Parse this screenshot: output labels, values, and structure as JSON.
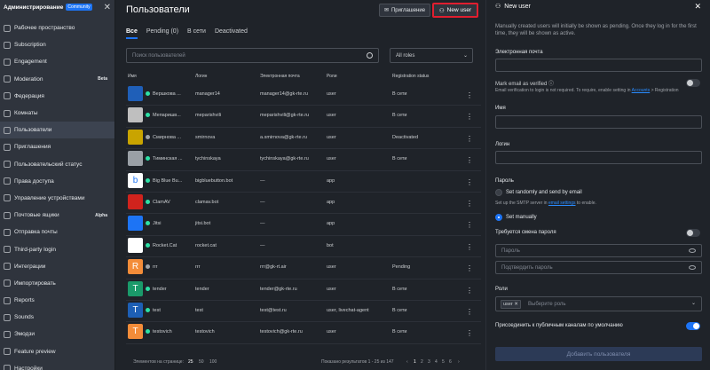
{
  "sidebar": {
    "title": "Администрирование",
    "badge": "Community",
    "items": [
      {
        "label": "Рабочее пространство",
        "icon": "workspace-icon"
      },
      {
        "label": "Subscription",
        "icon": "card-icon"
      },
      {
        "label": "Engagement",
        "icon": "chart-icon"
      },
      {
        "label": "Moderation",
        "icon": "shield-icon",
        "badge": "Beta"
      },
      {
        "label": "Федерация",
        "icon": "globe-icon"
      },
      {
        "label": "Комнаты",
        "icon": "hash-icon"
      },
      {
        "label": "Пользователи",
        "icon": "users-icon",
        "active": true
      },
      {
        "label": "Приглашения",
        "icon": "mail-icon"
      },
      {
        "label": "Пользовательский статус",
        "icon": "status-icon"
      },
      {
        "label": "Права доступа",
        "icon": "key-icon"
      },
      {
        "label": "Управление устройствами",
        "icon": "devices-icon"
      },
      {
        "label": "Почтовые ящики",
        "icon": "inbox-icon",
        "badge": "Alpha"
      },
      {
        "label": "Отправка почты",
        "icon": "send-icon"
      },
      {
        "label": "Third-party login",
        "icon": "login-icon"
      },
      {
        "label": "Интеграции",
        "icon": "code-icon"
      },
      {
        "label": "Импортировать",
        "icon": "import-icon"
      },
      {
        "label": "Reports",
        "icon": "report-icon"
      },
      {
        "label": "Sounds",
        "icon": "sound-icon"
      },
      {
        "label": "Эмодзи",
        "icon": "emoji-icon"
      },
      {
        "label": "Feature preview",
        "icon": "flask-icon"
      },
      {
        "label": "Настройки",
        "icon": "gear-icon"
      }
    ]
  },
  "main": {
    "title": "Пользователи",
    "invite_label": "Приглашение",
    "new_user_label": "New user",
    "tabs": [
      "Все",
      "Pending (0)",
      "В сети",
      "Deactivated"
    ],
    "search_placeholder": "Поиск пользователей",
    "roles_select": "All roles",
    "columns": [
      "Имя",
      "Логин",
      "Электронная почта",
      "Роли",
      "Registration status"
    ],
    "rows": [
      {
        "name": "Вершкова ...",
        "login": "manager14",
        "email": "manager14@gk-rte.ru",
        "roles": "user",
        "status": "В сети",
        "color": "#1f5fb8",
        "initial": "",
        "online": true
      },
      {
        "name": "Мепаришв...",
        "login": "meparishvili",
        "email": "meparishvili@gk-rte.ru",
        "roles": "user",
        "status": "В сети",
        "color": "#bfbfbf",
        "initial": "",
        "online": true
      },
      {
        "name": "Смирнова ...",
        "login": "smirnova",
        "email": "a.smirnova@gk-rte.ru",
        "roles": "user",
        "status": "Deactivated",
        "color": "#c9a400",
        "initial": "",
        "online": false
      },
      {
        "name": "Тиминская ...",
        "login": "tychinskaya",
        "email": "tychinskaya@gk-rte.ru",
        "roles": "user",
        "status": "В сети",
        "color": "#9aa0a6",
        "initial": "",
        "online": true
      },
      {
        "name": "Big Blue Bu...",
        "login": "bigbluebutton.bot",
        "email": "—",
        "roles": "app",
        "status": "",
        "color": "#ffffff",
        "initial": "b",
        "online": true
      },
      {
        "name": "ClamAV",
        "login": "clamav.bot",
        "email": "—",
        "roles": "app",
        "status": "",
        "color": "#d0231d",
        "initial": "",
        "online": true
      },
      {
        "name": "Jitsi",
        "login": "jitsi.bot",
        "email": "—",
        "roles": "app",
        "status": "",
        "color": "#1d74f5",
        "initial": "",
        "online": true
      },
      {
        "name": "Rocket.Cat",
        "login": "rocket.cat",
        "email": "—",
        "roles": "bot",
        "status": "",
        "color": "#ffffff",
        "initial": "",
        "online": true
      },
      {
        "name": "rrr",
        "login": "rrr",
        "email": "rrr@gk-rt.air",
        "roles": "user",
        "status": "Pending",
        "color": "#f38c39",
        "initial": "R",
        "online": false
      },
      {
        "name": "tender",
        "login": "tender",
        "email": "tender@gk-rte.ru",
        "roles": "user",
        "status": "В сети",
        "color": "#1a9a6a",
        "initial": "T",
        "online": true
      },
      {
        "name": "test",
        "login": "test",
        "email": "test@test.ru",
        "roles": "user, livechat-agent",
        "status": "В сети",
        "color": "#1d5fb5",
        "initial": "T",
        "online": true
      },
      {
        "name": "testovich",
        "login": "testovich",
        "email": "testovich@gk-rte.ru",
        "roles": "user",
        "status": "В сети",
        "color": "#f38c39",
        "initial": "T",
        "online": true
      }
    ],
    "pager": {
      "items_per_page_label": "Элементов на странице:",
      "sizes": [
        "25",
        "50",
        "100"
      ],
      "results": "Показано результатов 1 - 25 из 147",
      "pages": [
        "1",
        "2",
        "3",
        "4",
        "5",
        "6"
      ]
    }
  },
  "panel": {
    "title": "New user",
    "note": "Manually created users will initially be shown as pending. Once they log in for the first time, they will be shown as active.",
    "email_label": "Электронная почта",
    "verified_label": "Mark email as verified",
    "verified_note_prefix": "Email verification to login is not required. To require, enable setting in",
    "verified_note_link": "Accounts",
    "verified_note_suffix": "> Registration",
    "name_label": "Имя",
    "login_label": "Логин",
    "password_section": "Пароль",
    "set_random_label": "Set randomly and send by email",
    "smtp_note_prefix": "Set up the SMTP server in",
    "smtp_note_link": "email settings",
    "smtp_note_suffix": "to enable.",
    "set_manually_label": "Set manually",
    "require_change_label": "Требуется смена пароля",
    "password_placeholder": "Пароль",
    "confirm_placeholder": "Подтвердить пароль",
    "roles_label": "Роли",
    "role_chip": "user",
    "roles_placeholder": "Выберите роль",
    "join_default_label": "Присоединить к публичным каналам по умолчанию",
    "submit_label": "Добавить пользователя"
  }
}
